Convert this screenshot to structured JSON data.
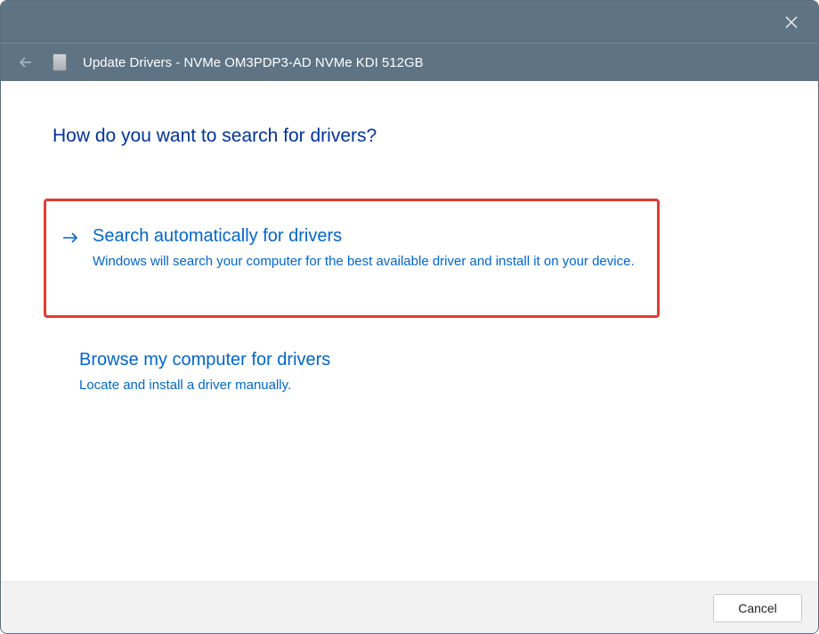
{
  "titlebar": {},
  "header": {
    "title": "Update Drivers - NVMe OM3PDP3-AD NVMe KDI 512GB"
  },
  "content": {
    "question": "How do you want to search for drivers?",
    "options": [
      {
        "title": "Search automatically for drivers",
        "description": "Windows will search your computer for the best available driver and install it on your device.",
        "highlighted": true
      },
      {
        "title": "Browse my computer for drivers",
        "description": "Locate and install a driver manually.",
        "highlighted": false
      }
    ]
  },
  "footer": {
    "cancel_label": "Cancel"
  }
}
